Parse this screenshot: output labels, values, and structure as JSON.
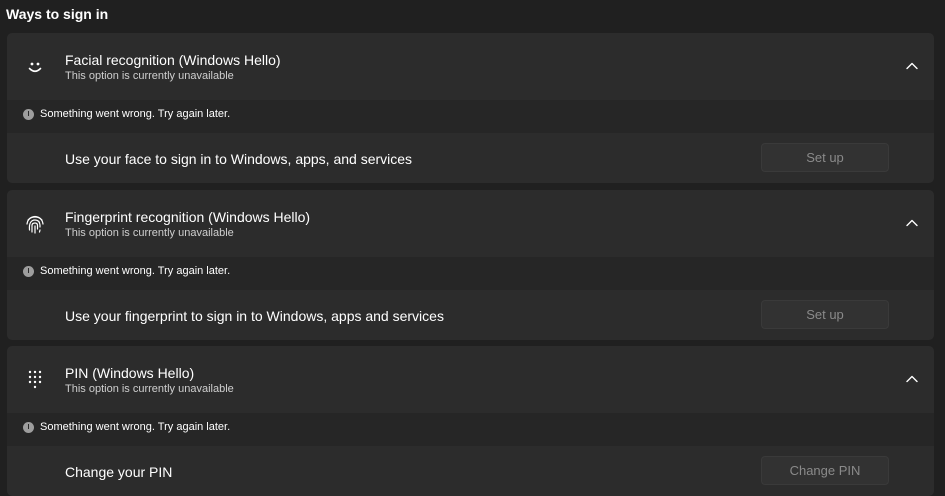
{
  "section_title": "Ways to sign in",
  "options": [
    {
      "title": "Facial recognition (Windows Hello)",
      "subtitle": "This option is currently unavailable",
      "icon": "face-icon",
      "error": "Something went wrong. Try again later.",
      "row_label": "Use your face to sign in to Windows, apps, and services",
      "button": "Set up"
    },
    {
      "title": "Fingerprint recognition (Windows Hello)",
      "subtitle": "This option is currently unavailable",
      "icon": "fingerprint-icon",
      "error": "Something went wrong. Try again later.",
      "row_label": "Use your fingerprint to sign in to Windows, apps and services",
      "button": "Set up"
    },
    {
      "title": "PIN (Windows Hello)",
      "subtitle": "This option is currently unavailable",
      "icon": "pin-keypad-icon",
      "error": "Something went wrong. Try again later.",
      "row_label": "Change your PIN",
      "button": "Change PIN"
    }
  ]
}
